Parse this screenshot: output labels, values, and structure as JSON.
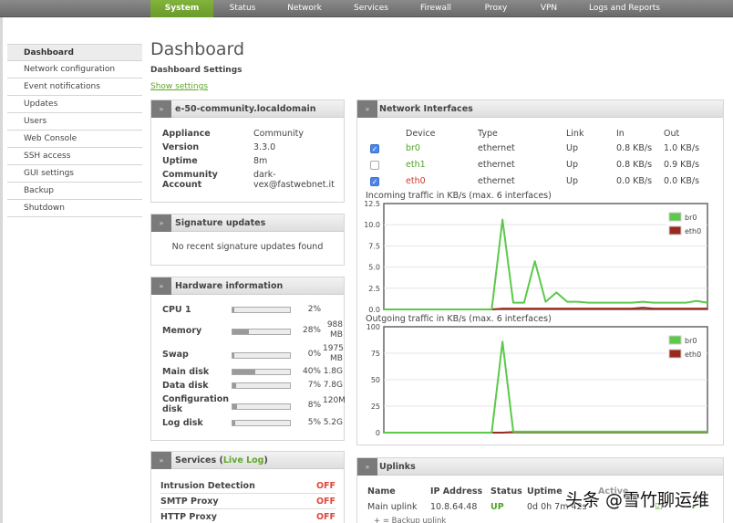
{
  "topnav": {
    "tabs": [
      {
        "label": "System",
        "active": true
      },
      {
        "label": "Status"
      },
      {
        "label": "Network"
      },
      {
        "label": "Services"
      },
      {
        "label": "Firewall"
      },
      {
        "label": "Proxy"
      },
      {
        "label": "VPN"
      },
      {
        "label": "Logs and Reports"
      }
    ]
  },
  "sidebar": {
    "items": [
      {
        "label": "Dashboard",
        "active": true
      },
      {
        "label": "Network configuration"
      },
      {
        "label": "Event notifications"
      },
      {
        "label": "Updates"
      },
      {
        "label": "Users"
      },
      {
        "label": "Web Console"
      },
      {
        "label": "SSH access"
      },
      {
        "label": "GUI settings"
      },
      {
        "label": "Backup"
      },
      {
        "label": "Shutdown"
      }
    ]
  },
  "page": {
    "title": "Dashboard",
    "settings_heading": "Dashboard Settings",
    "show_settings_link": "Show settings"
  },
  "host_panel": {
    "title": "e-50-community.localdomain",
    "chevron": "»",
    "rows": [
      {
        "key": "Appliance",
        "value": "Community"
      },
      {
        "key": "Version",
        "value": "3.3.0"
      },
      {
        "key": "Uptime",
        "value": "8m"
      },
      {
        "key": "Community",
        "key2": "Account",
        "value": "dark-",
        "value2": "vex@fastwebnet.it"
      }
    ]
  },
  "signature_panel": {
    "title": "Signature updates",
    "message": "No recent signature updates found"
  },
  "hardware_panel": {
    "title": "Hardware information",
    "rows": [
      {
        "label": "CPU 1",
        "percent": 2,
        "percent_text": "2%",
        "size": ""
      },
      {
        "label": "Memory",
        "percent": 28,
        "percent_text": "28%",
        "size": "988",
        "size2": "MB"
      },
      {
        "label": "Swap",
        "percent": 0,
        "percent_text": "0%",
        "size": "1975",
        "size2": "MB"
      },
      {
        "label": "Main disk",
        "percent": 40,
        "percent_text": "40%",
        "size": "1.8G"
      },
      {
        "label": "Data disk",
        "percent": 7,
        "percent_text": "7%",
        "size": "7.8G"
      },
      {
        "label": "Configuration",
        "label2": "disk",
        "percent": 8,
        "percent_text": "8%",
        "size": "120M"
      },
      {
        "label": "Log disk",
        "percent": 5,
        "percent_text": "5%",
        "size": "5.2G"
      }
    ]
  },
  "services_panel": {
    "title_prefix": "Services (",
    "live_log_link": "Live Log",
    "title_suffix": ")",
    "rows": [
      {
        "name": "Intrusion Detection",
        "status": "OFF"
      },
      {
        "name": "SMTP Proxy",
        "status": "OFF"
      },
      {
        "name": "HTTP Proxy",
        "status": "OFF"
      }
    ]
  },
  "network_panel": {
    "title": "Network Interfaces",
    "columns": [
      "Device",
      "Type",
      "Link",
      "In",
      "Out"
    ],
    "rows": [
      {
        "checked": true,
        "device": "br0",
        "type": "ethernet",
        "link": "Up",
        "in": "0.8 KB/s",
        "out": "1.0 KB/s",
        "color": "green"
      },
      {
        "checked": false,
        "device": "eth1",
        "type": "ethernet",
        "link": "Up",
        "in": "0.8 KB/s",
        "out": "0.9 KB/s",
        "color": "green"
      },
      {
        "checked": true,
        "device": "eth0",
        "type": "ethernet",
        "link": "Up",
        "in": "0.0 KB/s",
        "out": "0.0 KB/s",
        "color": "red"
      }
    ]
  },
  "chart_data": [
    {
      "type": "line",
      "title": "Incoming traffic in KB/s (max. 6 interfaces)",
      "xlabel": "",
      "ylabel": "",
      "ylim": [
        0,
        12.5
      ],
      "yticks": [
        "0.0",
        "2.5",
        "5.0",
        "7.5",
        "10.0",
        "12.5"
      ],
      "ytick_values": [
        0,
        2.5,
        5,
        7.5,
        10,
        12.5
      ],
      "grid": true,
      "legend": "top-right",
      "series": [
        {
          "name": "br0",
          "color": "#5cc94a",
          "values": [
            0,
            0,
            0,
            0,
            0,
            0,
            0,
            0,
            0,
            0,
            0,
            10.6,
            0.8,
            0.8,
            5.7,
            0.9,
            2.0,
            0.9,
            0.9,
            0.8,
            0.8,
            0.8,
            0.8,
            0.8,
            0.9,
            0.8,
            0.8,
            0.8,
            0.8,
            1.0,
            0.8
          ]
        },
        {
          "name": "eth0",
          "color": "#9b2a1e",
          "values": [
            0,
            0,
            0,
            0,
            0,
            0,
            0,
            0,
            0,
            0,
            0,
            0.1,
            0.1,
            0.1,
            0.1,
            0.1,
            0.1,
            0.1,
            0.1,
            0.1,
            0.1,
            0.1,
            0.1,
            0.1,
            0.2,
            0.1,
            0.1,
            0.1,
            0.1,
            0.1,
            0.1
          ]
        }
      ]
    },
    {
      "type": "line",
      "title": "Outgoing traffic in KB/s (max. 6 interfaces)",
      "xlabel": "",
      "ylabel": "",
      "ylim": [
        0,
        100
      ],
      "yticks": [
        "0",
        "25",
        "50",
        "75",
        "100"
      ],
      "ytick_values": [
        0,
        25,
        50,
        75,
        100
      ],
      "grid": true,
      "legend": "top-right",
      "series": [
        {
          "name": "br0",
          "color": "#5cc94a",
          "values": [
            0,
            0,
            0,
            0,
            0,
            0,
            0,
            0,
            0,
            0,
            0,
            86,
            1,
            1,
            1,
            1,
            1,
            1,
            1,
            1,
            1,
            1,
            1,
            1,
            1,
            1,
            1,
            1,
            1,
            1,
            1
          ]
        },
        {
          "name": "eth0",
          "color": "#9b2a1e",
          "values": [
            0,
            0,
            0,
            0,
            0,
            0,
            0,
            0,
            0,
            0,
            0,
            0,
            0.5,
            0.5,
            0.5,
            0.5,
            0.5,
            0.5,
            0.5,
            0.5,
            0.5,
            0.5,
            0.5,
            0.5,
            0.5,
            0.5,
            0.5,
            0.5,
            0.5,
            0.5,
            0.5
          ]
        }
      ]
    }
  ],
  "uplinks_panel": {
    "title": "Uplinks",
    "columns": [
      "Name",
      "IP Address",
      "Status",
      "Uptime",
      "Active"
    ],
    "rows": [
      {
        "name": "Main uplink",
        "ip": "10.8.64.48",
        "status": "UP",
        "uptime": "0d 0h 7m 42s"
      }
    ],
    "backup_note": "+ = Backup uplink"
  },
  "watermark": "头条 @雪竹聊运维"
}
